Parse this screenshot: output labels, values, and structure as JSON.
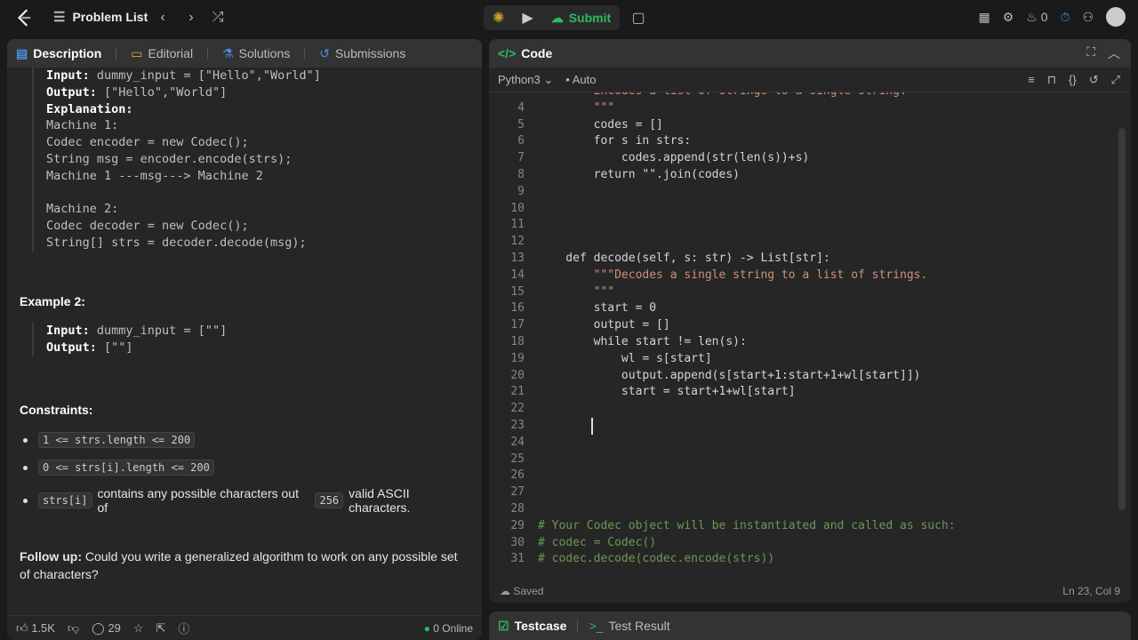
{
  "topbar": {
    "problem_list": "Problem List",
    "submit_label": "Submit",
    "streak": "0"
  },
  "left_tabs": [
    "Description",
    "Editorial",
    "Solutions",
    "Submissions"
  ],
  "example1": {
    "lines": [
      {
        "key": "Input:",
        "val": " dummy_input = [\"Hello\",\"World\"]"
      },
      {
        "key": "Output:",
        "val": " [\"Hello\",\"World\"]"
      },
      {
        "key": "Explanation:",
        "val": ""
      },
      {
        "key": "",
        "val": "Machine 1:"
      },
      {
        "key": "",
        "val": "Codec encoder = new Codec();"
      },
      {
        "key": "",
        "val": "String msg = encoder.encode(strs);"
      },
      {
        "key": "",
        "val": "Machine 1 ---msg---> Machine 2"
      },
      {
        "key": "",
        "val": ""
      },
      {
        "key": "",
        "val": "Machine 2:"
      },
      {
        "key": "",
        "val": "Codec decoder = new Codec();"
      },
      {
        "key": "",
        "val": "String[] strs = decoder.decode(msg);"
      }
    ]
  },
  "example2": {
    "heading": "Example 2:",
    "input_key": "Input:",
    "input_val": " dummy_input = [\"\"]",
    "output_key": "Output:",
    "output_val": " [\"\"]"
  },
  "constraints": {
    "heading": "Constraints:",
    "c1": "1 <= strs.length <= 200",
    "c2": "0 <= strs[i].length <= 200",
    "c3_chip": "strs[i]",
    "c3_text1": "contains any possible characters out of",
    "c3_chip2": "256",
    "c3_text2": "valid ASCII characters."
  },
  "followup": {
    "label": "Follow up:",
    "text": " Could you write a generalized algorithm to work on any possible set of characters?"
  },
  "left_footer": {
    "likes": "1.5K",
    "comments": "29",
    "online": "0 Online"
  },
  "code_panel": {
    "title": "Code",
    "language": "Python3",
    "mode": "Auto",
    "saved": "Saved",
    "cursor": "Ln 23, Col 9"
  },
  "bottom_tabs": [
    "Testcase",
    "Test Result"
  ],
  "code_lines": [
    {
      "n": "",
      "t": "        Encodes a list of strings to a single string."
    },
    {
      "n": "4",
      "t": "        \"\"\""
    },
    {
      "n": "5",
      "t": "        codes = []"
    },
    {
      "n": "6",
      "t": "        for s in strs:"
    },
    {
      "n": "7",
      "t": "            codes.append(str(len(s))+s)"
    },
    {
      "n": "8",
      "t": "        return \"\".join(codes)"
    },
    {
      "n": "9",
      "t": ""
    },
    {
      "n": "10",
      "t": ""
    },
    {
      "n": "11",
      "t": ""
    },
    {
      "n": "12",
      "t": ""
    },
    {
      "n": "13",
      "t": "    def decode(self, s: str) -> List[str]:"
    },
    {
      "n": "14",
      "t": "        \"\"\"Decodes a single string to a list of strings."
    },
    {
      "n": "15",
      "t": "        \"\"\""
    },
    {
      "n": "16",
      "t": "        start = 0"
    },
    {
      "n": "17",
      "t": "        output = []"
    },
    {
      "n": "18",
      "t": "        while start != len(s):"
    },
    {
      "n": "19",
      "t": "            wl = s[start]"
    },
    {
      "n": "20",
      "t": "            output.append(s[start+1:start+1+wl[start]])"
    },
    {
      "n": "21",
      "t": "            start = start+1+wl[start]"
    },
    {
      "n": "22",
      "t": ""
    },
    {
      "n": "23",
      "t": ""
    },
    {
      "n": "24",
      "t": ""
    },
    {
      "n": "25",
      "t": ""
    },
    {
      "n": "26",
      "t": ""
    },
    {
      "n": "27",
      "t": ""
    },
    {
      "n": "28",
      "t": ""
    },
    {
      "n": "29",
      "t": "# Your Codec object will be instantiated and called as such:"
    },
    {
      "n": "30",
      "t": "# codec = Codec()"
    },
    {
      "n": "31",
      "t": "# codec.decode(codec.encode(strs))"
    }
  ]
}
